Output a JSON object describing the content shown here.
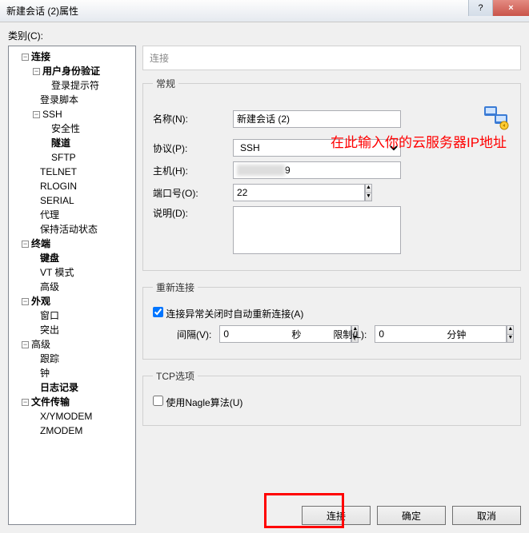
{
  "window": {
    "title": "新建会话 (2)属性",
    "help": "?",
    "close": "×"
  },
  "category_label": "类别(C):",
  "tree": {
    "connection": "连接",
    "user_auth": "用户身份验证",
    "login_prompt": "登录提示符",
    "login_script": "登录脚本",
    "ssh": "SSH",
    "security": "安全性",
    "tunnel": "隧道",
    "sftp": "SFTP",
    "telnet": "TELNET",
    "rlogin": "RLOGIN",
    "serial": "SERIAL",
    "proxy": "代理",
    "keepalive": "保持活动状态",
    "terminal": "终端",
    "keyboard": "键盘",
    "vtmode": "VT 模式",
    "advanced": "高级",
    "appearance": "外观",
    "window": "窗口",
    "highlight": "突出",
    "advanced2": "高级",
    "trace": "跟踪",
    "bell": "钟",
    "logging": "日志记录",
    "filetransfer": "文件传输",
    "xymodem": "X/YMODEM",
    "zmodem": "ZMODEM"
  },
  "crumb": "连接",
  "general": {
    "legend": "常规",
    "name_label": "名称(N):",
    "name_value": "新建会话 (2)",
    "protocol_label": "协议(P):",
    "protocol_value": "SSH",
    "host_label": "主机(H):",
    "host_suffix": "9",
    "port_label": "端口号(O):",
    "port_value": "22",
    "desc_label": "说明(D):",
    "desc_value": ""
  },
  "reconnect": {
    "legend": "重新连接",
    "checkbox_label": "连接异常关闭时自动重新连接(A)",
    "checked": true,
    "interval_label": "间隔(V):",
    "interval_value": "0",
    "interval_unit": "秒",
    "limit_label": "限制(L):",
    "limit_value": "0",
    "limit_unit": "分钟"
  },
  "tcpopt": {
    "legend": "TCP选项",
    "nagle_label": "使用Nagle算法(U)",
    "nagle_checked": false
  },
  "annotation": "在此输入你的云服务器IP地址",
  "buttons": {
    "connect": "连接",
    "ok": "确定",
    "cancel": "取消"
  }
}
